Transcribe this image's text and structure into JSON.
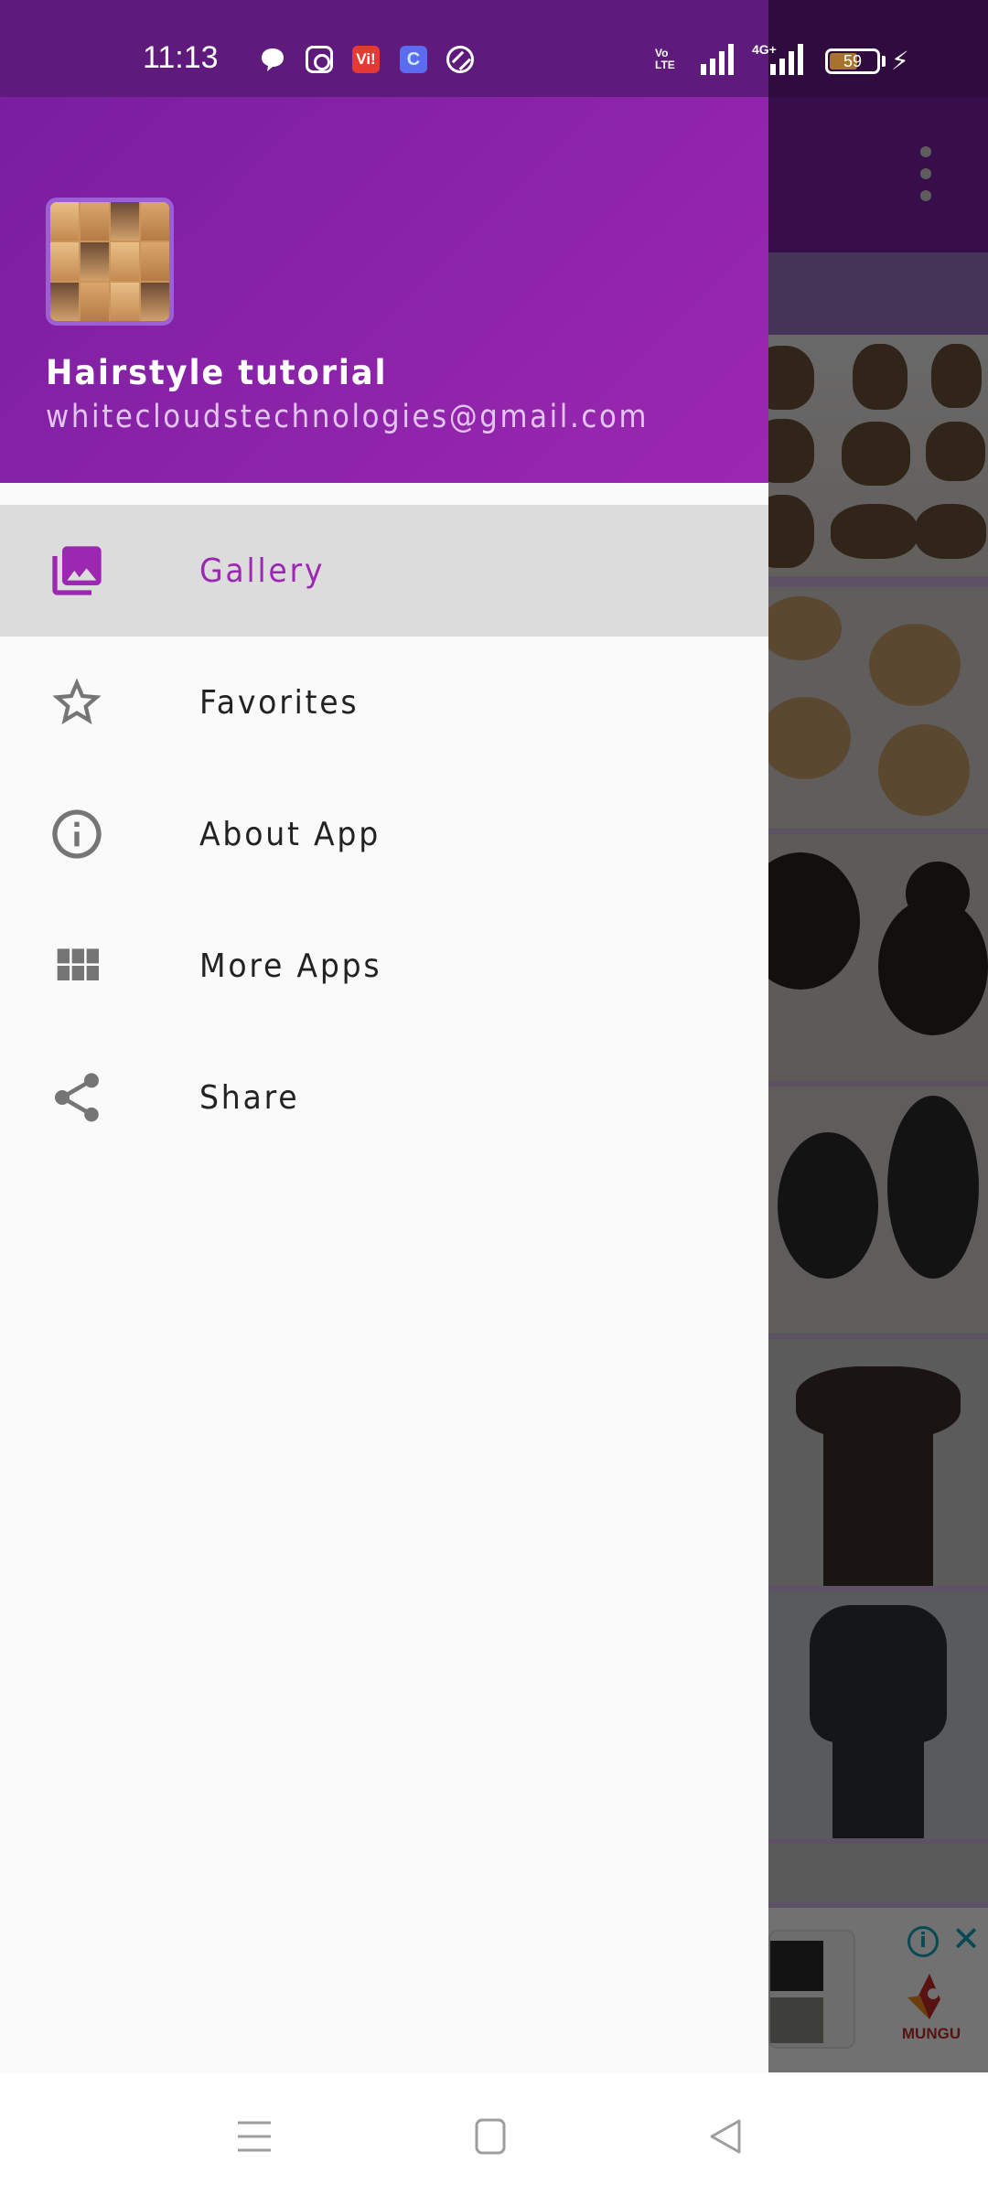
{
  "status_bar": {
    "time": "11:13",
    "notification_icons": [
      "chat-bubble-icon",
      "instagram-icon",
      "vi-app-icon",
      "c-app-icon",
      "payment-app-icon"
    ],
    "vi_label": "Vi!",
    "c_label": "C",
    "volte_line1": "Vo",
    "volte_line2": "LTE",
    "network_label": "4G+",
    "battery_percent": "59",
    "battery_level": 0.59,
    "charging": true
  },
  "drawer": {
    "header": {
      "app_name": "Hairstyle tutorial",
      "email": "whitecloudstechnologies@gmail.com",
      "colors": {
        "header_start": "#7a1ea0",
        "header_end": "#9c27b0",
        "email_text": "#e3c3f2"
      }
    },
    "menu": [
      {
        "label": "Gallery",
        "icon": "photo-library-icon",
        "selected": true
      },
      {
        "label": "Favorites",
        "icon": "star-outline-icon",
        "selected": false
      },
      {
        "label": "About App",
        "icon": "info-icon",
        "selected": false
      },
      {
        "label": "More Apps",
        "icon": "grid-apps-icon",
        "selected": false
      },
      {
        "label": "Share",
        "icon": "share-icon",
        "selected": false
      }
    ],
    "accent_color": "#9c27b0"
  },
  "background_app": {
    "overflow_menu_icon": "more-vert-icon",
    "ad": {
      "brand": "MUNGU",
      "info_glyph": "i",
      "close_glyph": "✕"
    }
  },
  "nav_bar": {
    "buttons": [
      "recents-menu",
      "home",
      "back"
    ]
  }
}
